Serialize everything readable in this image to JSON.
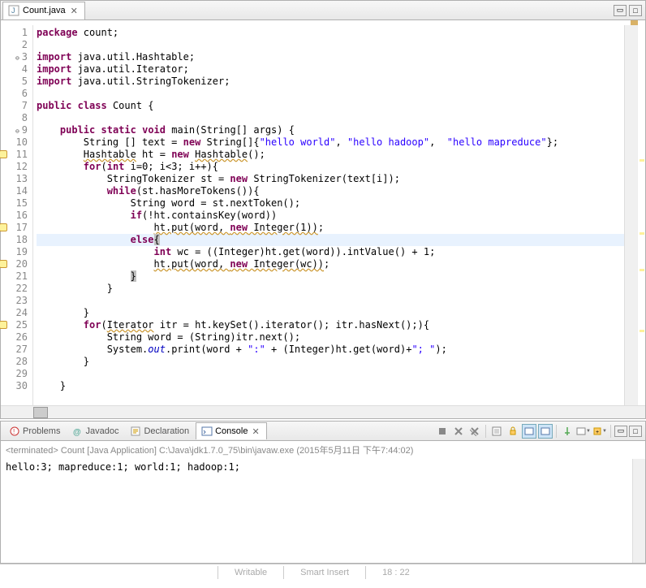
{
  "editor": {
    "tab_title": "Count.java",
    "lines": [
      {
        "n": "1",
        "html": "<span class='kw'>package</span> count;"
      },
      {
        "n": "2",
        "html": ""
      },
      {
        "n": "3",
        "circ": "⊖",
        "html": "<span class='kw'>import</span> java.util.Hashtable;"
      },
      {
        "n": "4",
        "html": "<span class='kw'>import</span> java.util.Iterator;"
      },
      {
        "n": "5",
        "html": "<span class='kw'>import</span> java.util.StringTokenizer;"
      },
      {
        "n": "6",
        "html": ""
      },
      {
        "n": "7",
        "html": "<span class='kw'>public</span> <span class='kw'>class</span> Count {"
      },
      {
        "n": "8",
        "html": ""
      },
      {
        "n": "9",
        "circ": "⊖",
        "html": "    <span class='kw'>public</span> <span class='kw'>static</span> <span class='kw'>void</span> main(String[] args) {"
      },
      {
        "n": "10",
        "html": "        String [] text = <span class='kw'>new</span> String[]{<span class='str'>\"hello world\"</span>, <span class='str'>\"hello hadoop\"</span>,  <span class='str'>\"hello mapreduce\"</span>};"
      },
      {
        "n": "11",
        "warn": true,
        "html": "        <span class='warn'>Hashtable</span> ht = <span class='kw'>new</span> <span class='warn'>Hashtable</span>();"
      },
      {
        "n": "12",
        "html": "        <span class='kw'>for</span>(<span class='kw'>int</span> i=0; i&lt;3; i++){"
      },
      {
        "n": "13",
        "html": "            StringTokenizer st = <span class='kw'>new</span> StringTokenizer(text[i]);"
      },
      {
        "n": "14",
        "html": "            <span class='kw'>while</span>(st.hasMoreTokens()){"
      },
      {
        "n": "15",
        "html": "                String word = st.nextToken();"
      },
      {
        "n": "16",
        "html": "                <span class='kw'>if</span>(!ht.containsKey(word))"
      },
      {
        "n": "17",
        "warn": true,
        "html": "                    <span class='warn'>ht.put(word, <span class='kw'>new</span> Integer(1))</span>;"
      },
      {
        "n": "18",
        "hl": true,
        "html": "                <span class='kw'>else</span><span class='cursor-bracket'>{</span>"
      },
      {
        "n": "19",
        "html": "                    <span class='kw'>int</span> wc = ((Integer)ht.get(word)).intValue() + 1;"
      },
      {
        "n": "20",
        "warn": true,
        "html": "                    <span class='warn'>ht.put(word, <span class='kw'>new</span> Integer(wc))</span>;"
      },
      {
        "n": "21",
        "html": "                <span class='cursor-bracket'>}</span>"
      },
      {
        "n": "22",
        "html": "            }"
      },
      {
        "n": "23",
        "html": ""
      },
      {
        "n": "24",
        "html": "        }"
      },
      {
        "n": "25",
        "warn": true,
        "html": "        <span class='kw'>for</span>(<span class='warn'>Iterator</span> itr = ht.keySet().iterator(); itr.hasNext();){"
      },
      {
        "n": "26",
        "html": "            String word = (String)itr.next();"
      },
      {
        "n": "27",
        "html": "            System.<span class='fld'>out</span>.print(word + <span class='str'>\":\"</span> + (Integer)ht.get(word)+<span class='str'>\"; \"</span>);"
      },
      {
        "n": "28",
        "html": "        }"
      },
      {
        "n": "29",
        "html": ""
      },
      {
        "n": "30",
        "html": "    }"
      }
    ]
  },
  "views": {
    "problems": "Problems",
    "javadoc": "Javadoc",
    "declaration": "Declaration",
    "console": "Console"
  },
  "console": {
    "header": "<terminated> Count [Java Application] C:\\Java\\jdk1.7.0_75\\bin\\javaw.exe (2015年5月11日 下午7:44:02)",
    "output": "hello:3; mapreduce:1; world:1; hadoop:1; "
  },
  "status": {
    "writable": "Writable",
    "insert": "Smart Insert",
    "pos": "18 : 22"
  }
}
